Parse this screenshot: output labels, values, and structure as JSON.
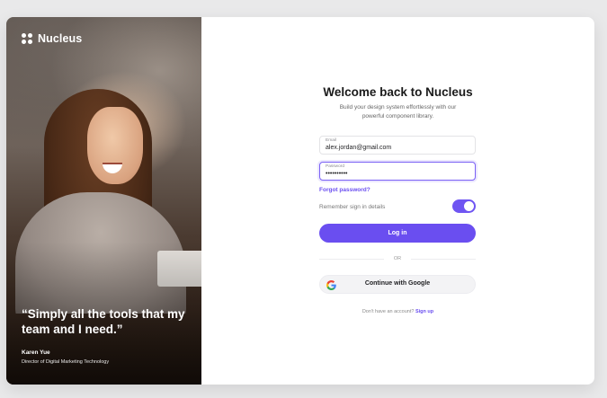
{
  "brand": {
    "name": "Nucleus",
    "icon": "nucleus-logo-icon"
  },
  "hero": {
    "quote": "“Simply all the tools that my team and I need.”",
    "author_name": "Karen Yue",
    "author_title": "Director of Digital Marketing Technology"
  },
  "form": {
    "title": "Welcome back to Nucleus",
    "subtitle_line1": "Build your design system effortlessly with our",
    "subtitle_line2": "powerful component library.",
    "email": {
      "label": "Email",
      "value": "alex.jordan@gmail.com"
    },
    "password": {
      "label": "Password",
      "value": "••••••••••"
    },
    "forgot_password": "Forgot password?",
    "remember_label": "Remember sign in details",
    "remember_enabled": true,
    "login_label": "Log in",
    "divider_label": "OR",
    "google_label": "Continue with Google",
    "signup_prompt": "Don't have an account?",
    "signup_link": "Sign up"
  },
  "colors": {
    "accent": "#6a4ef0",
    "background": "#e9e9ea",
    "card": "#ffffff"
  }
}
